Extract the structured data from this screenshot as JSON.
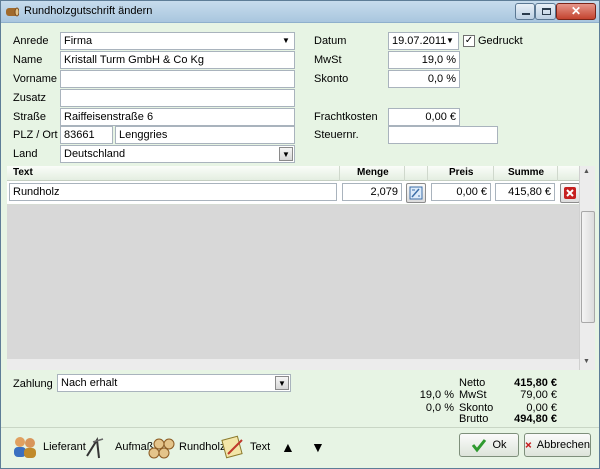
{
  "window": {
    "title": "Rundholzgutschrift ändern"
  },
  "form": {
    "anrede_label": "Anrede",
    "anrede_value": "Firma",
    "name_label": "Name",
    "name_value": "Kristall Turm GmbH & Co Kg",
    "vorname_label": "Vorname",
    "vorname_value": "",
    "zusatz_label": "Zusatz",
    "zusatz_value": "",
    "strasse_label": "Straße",
    "strasse_value": "Raiffeisenstraße 6",
    "plz_ort_label": "PLZ / Ort",
    "plz_value": "83661",
    "ort_value": "Lenggries",
    "land_label": "Land",
    "land_value": "Deutschland",
    "datum_label": "Datum",
    "datum_value": "19.07.2011",
    "gedruckt_label": "Gedruckt",
    "gedruckt_checked": true,
    "mwst_label": "MwSt",
    "mwst_value": "19,0 %",
    "skonto_label": "Skonto",
    "skonto_value": "0,0 %",
    "frachtkosten_label": "Frachtkosten",
    "frachtkosten_value": "0,00 €",
    "steuernr_label": "Steuernr.",
    "steuernr_value": ""
  },
  "grid": {
    "headers": {
      "text": "Text",
      "menge": "Menge",
      "preis": "Preis",
      "summe": "Summe"
    },
    "rows": [
      {
        "text": "Rundholz",
        "menge": "2,079",
        "preis": "0,00 €",
        "summe": "415,80 €"
      }
    ]
  },
  "footer": {
    "zahlung_label": "Zahlung",
    "zahlung_value": "Nach erhalt",
    "netto_label": "Netto",
    "netto_value": "415,80 €",
    "mwst_rate": "19,0 %",
    "mwst_label": "MwSt",
    "mwst_value": "79,00 €",
    "skonto_rate": "0,0 %",
    "skonto_label": "Skonto",
    "skonto_value": "0,00 €",
    "brutto_label": "Brutto",
    "brutto_value": "494,80 €"
  },
  "toolbar": {
    "lieferant": "Lieferant",
    "aufmass": "Aufmaß",
    "rundholz": "Rundholz",
    "text": "Text",
    "up": "▲",
    "down": "▼",
    "ok": "Ok",
    "abbrechen": "Abbrechen"
  },
  "icons": {
    "window": "log-icon",
    "lieferant": "people-icon",
    "aufmass": "measure-icon",
    "rundholz": "logs-icon",
    "text": "note-icon",
    "ok": "check-icon",
    "abbrechen": "x-icon",
    "delete": "delete-icon",
    "calc": "calc-icon"
  },
  "colors": {
    "form_bg": "#e7f4e4",
    "title_bg": "#b8d1e6",
    "close_red": "#c3432f",
    "ok_green": "#2f9a2f",
    "cancel_red": "#c62020"
  }
}
